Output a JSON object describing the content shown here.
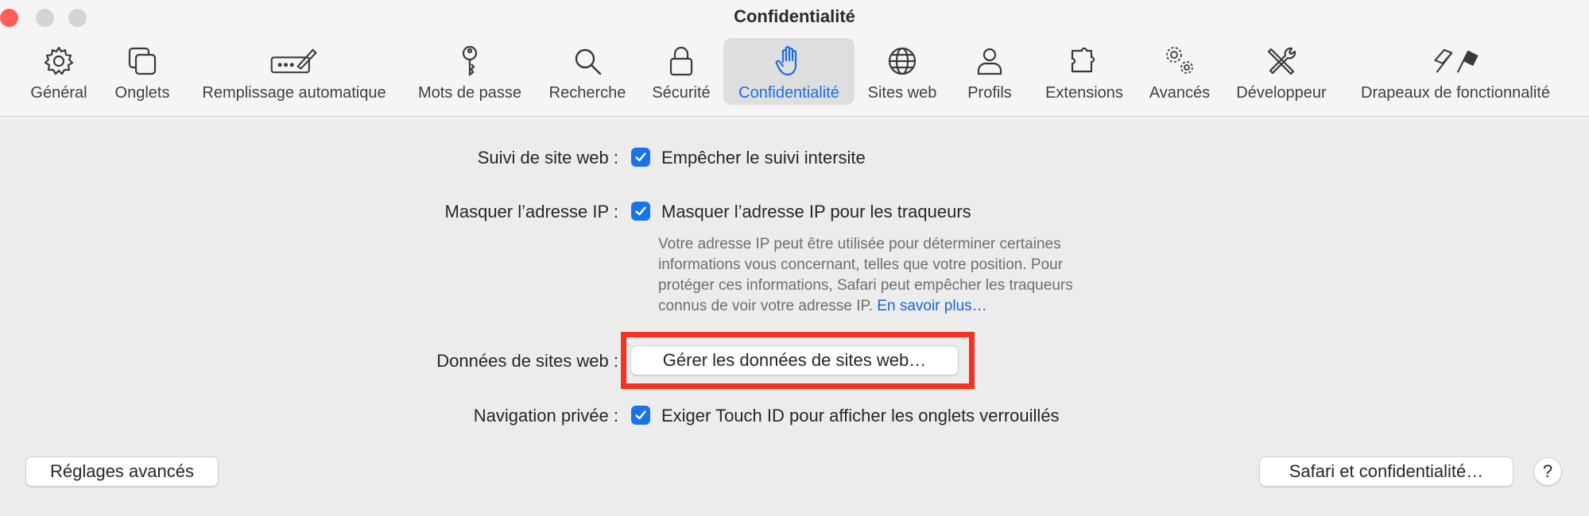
{
  "window": {
    "title": "Confidentialité"
  },
  "toolbar": {
    "tabs": [
      {
        "label": "Général",
        "icon": "gear-icon"
      },
      {
        "label": "Onglets",
        "icon": "tabs-icon"
      },
      {
        "label": "Remplissage automatique",
        "icon": "autofill-pen-icon"
      },
      {
        "label": "Mots de passe",
        "icon": "key-icon"
      },
      {
        "label": "Recherche",
        "icon": "magnifier-icon"
      },
      {
        "label": "Sécurité",
        "icon": "lock-icon"
      },
      {
        "label": "Confidentialité",
        "icon": "hand-icon"
      },
      {
        "label": "Sites web",
        "icon": "globe-icon"
      },
      {
        "label": "Profils",
        "icon": "person-icon"
      },
      {
        "label": "Extensions",
        "icon": "puzzle-icon"
      },
      {
        "label": "Avancés",
        "icon": "gears-icon"
      },
      {
        "label": "Développeur",
        "icon": "tools-icon"
      },
      {
        "label": "Drapeaux de fonctionnalité",
        "icon": "flags-icon"
      }
    ],
    "active_tab": "Confidentialité"
  },
  "privacy": {
    "tracking": {
      "label": "Suivi de site web :",
      "option": "Empêcher le suivi intersite",
      "checked": true
    },
    "ip": {
      "label": "Masquer l’adresse IP :",
      "option": "Masquer l’adresse IP pour les traqueurs",
      "checked": true,
      "help_lines": [
        "Votre adresse IP peut être utilisée pour déterminer certaines",
        "informations vous concernant, telles que votre position. Pour",
        "protéger ces informations, Safari peut empêcher les traqueurs",
        "connus de voir votre adresse IP."
      ],
      "help_link": "En savoir plus…"
    },
    "website_data": {
      "label": "Données de sites web :",
      "button": "Gérer les données de sites web…"
    },
    "private_browsing": {
      "label": "Navigation privée :",
      "option": "Exiger Touch ID pour afficher les onglets verrouillés",
      "checked": true
    }
  },
  "footer": {
    "advanced_button": "Réglages avancés",
    "privacy_button": "Safari et confidentialité…",
    "help_button": "?"
  },
  "colors": {
    "accent": "#1a73e8",
    "highlight_box": "#f5311f"
  }
}
